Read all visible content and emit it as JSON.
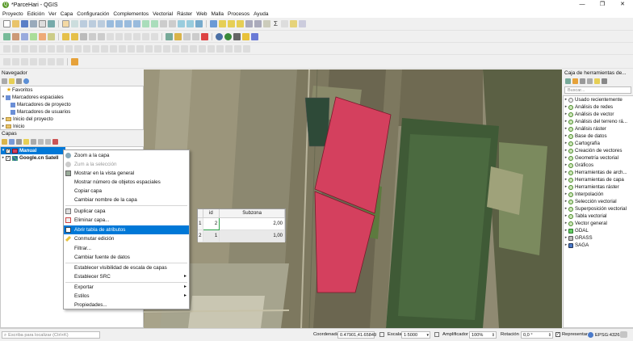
{
  "window": {
    "title": "*ParceHari - QGIS",
    "logo": "Q",
    "controls": [
      "—",
      "❐",
      "✕"
    ]
  },
  "menu": [
    "Proyecto",
    "Edición",
    "Ver",
    "Capa",
    "Configuración",
    "Complementos",
    "Vectorial",
    "Ráster",
    "Web",
    "Malla",
    "Procesos",
    "Ayuda"
  ],
  "navigator": {
    "title": "Navegador",
    "items": [
      {
        "label": "Favoritos",
        "icon": "star-icon",
        "expanded": false
      },
      {
        "label": "Marcadores espaciales",
        "icon": "bookmark-folder-icon",
        "expanded": true
      },
      {
        "label": "Marcadores de proyecto",
        "icon": "bookmark-folder-icon",
        "indent": 1
      },
      {
        "label": "Marcadores de usuarios",
        "icon": "bookmark-folder-icon",
        "indent": 1
      },
      {
        "label": "Inicio del proyecto",
        "icon": "folder-icon",
        "expanded": false
      },
      {
        "label": "Inicio",
        "icon": "folder-icon",
        "expanded": false
      }
    ]
  },
  "layers": {
    "title": "Capas",
    "items": [
      {
        "label": "Manual",
        "checked": true,
        "selected": true
      },
      {
        "label": "Google.cn Satell",
        "checked": true
      }
    ]
  },
  "context_menu": {
    "items": [
      {
        "label": "Zoom a la capa",
        "icon": "zoom-layer-icon"
      },
      {
        "label": "Zum a la selección",
        "icon": "zoom-selection-icon",
        "disabled": true
      },
      {
        "label": "Mostrar en la vista general",
        "icon": "overview-icon"
      },
      {
        "label": "Mostrar número de objetos espaciales",
        "icon": "none"
      },
      {
        "label": "Copiar capa",
        "icon": "none"
      },
      {
        "label": "Cambiar nombre de la capa",
        "icon": "none"
      },
      {
        "label": "Duplicar capa",
        "icon": "duplicate-icon"
      },
      {
        "label": "Eliminar capa...",
        "icon": "remove-layer-icon"
      },
      {
        "label": "Abrir tabla de atributos",
        "icon": "table-icon",
        "selected": true
      },
      {
        "label": "Conmutar edición",
        "icon": "pencil-icon"
      },
      {
        "label": "Filtrar...",
        "icon": "none"
      },
      {
        "label": "Cambiar fuente de datos",
        "icon": "none"
      },
      {
        "label": "Establecer visibilidad de escala de capas",
        "icon": "none"
      },
      {
        "label": "Establecer SRC",
        "icon": "none",
        "submenu": true
      },
      {
        "label": "Exportar",
        "icon": "none",
        "submenu": true
      },
      {
        "label": "Estilos",
        "icon": "none",
        "submenu": true
      },
      {
        "label": "Propiedades...",
        "icon": "none"
      }
    ]
  },
  "attribute_table": {
    "columns": [
      "id",
      "Subzona"
    ],
    "rows": [
      {
        "row": "1",
        "id": "2",
        "subzona": "2,00"
      },
      {
        "row": "2",
        "id": "1",
        "subzona": "1,00"
      }
    ]
  },
  "toolbox": {
    "title": "Caja de herramientas de...",
    "search_placeholder": "Buscar...",
    "items": [
      {
        "label": "Usado recientemente",
        "icon": "clock-icon"
      },
      {
        "label": "Análisis de redes",
        "icon": "qgis-algorithm-icon"
      },
      {
        "label": "Análisis de vector",
        "icon": "qgis-algorithm-icon"
      },
      {
        "label": "Análisis del terreno rá...",
        "icon": "qgis-algorithm-icon"
      },
      {
        "label": "Análisis ráster",
        "icon": "qgis-algorithm-icon"
      },
      {
        "label": "Base de datos",
        "icon": "qgis-algorithm-icon"
      },
      {
        "label": "Cartografía",
        "icon": "qgis-algorithm-icon"
      },
      {
        "label": "Creación de vectores",
        "icon": "qgis-algorithm-icon"
      },
      {
        "label": "Geometría vectorial",
        "icon": "qgis-algorithm-icon"
      },
      {
        "label": "Gráficos",
        "icon": "qgis-algorithm-icon"
      },
      {
        "label": "Herramientas de arch...",
        "icon": "qgis-algorithm-icon"
      },
      {
        "label": "Herramientas de capa",
        "icon": "qgis-algorithm-icon"
      },
      {
        "label": "Herramientas ráster",
        "icon": "qgis-algorithm-icon"
      },
      {
        "label": "Interpolación",
        "icon": "qgis-algorithm-icon"
      },
      {
        "label": "Selección vectorial",
        "icon": "qgis-algorithm-icon"
      },
      {
        "label": "Superposición vectorial",
        "icon": "qgis-algorithm-icon"
      },
      {
        "label": "Tabla vectorial",
        "icon": "qgis-algorithm-icon"
      },
      {
        "label": "Vector general",
        "icon": "qgis-algorithm-icon"
      },
      {
        "label": "GDAL",
        "icon": "gdal-icon"
      },
      {
        "label": "GRASS",
        "icon": "grass-icon"
      },
      {
        "label": "SAGA",
        "icon": "saga-icon"
      }
    ]
  },
  "statusbar": {
    "search_placeholder": "Escriba para localizar (Ctrl+K)",
    "coord_label": "Coordenada",
    "coord_value": "0.47901,41.65849",
    "scale_label": "Escala",
    "scale_value": "1:5000",
    "magnifier_label": "Amplificador",
    "magnifier_value": "100%",
    "rotation_label": "Rotación",
    "rotation_value": "0,0 °",
    "render_label": "Representar",
    "render_checked": true,
    "crs": "EPSG:4326"
  },
  "colors": {
    "polygon_fill": "#d4405e",
    "polygon_stroke": "#7a1a2c",
    "selection_blue": "#0078d7",
    "attr_selected_cell": "#2ea34a",
    "qgis_green": "#5a9a2b"
  }
}
